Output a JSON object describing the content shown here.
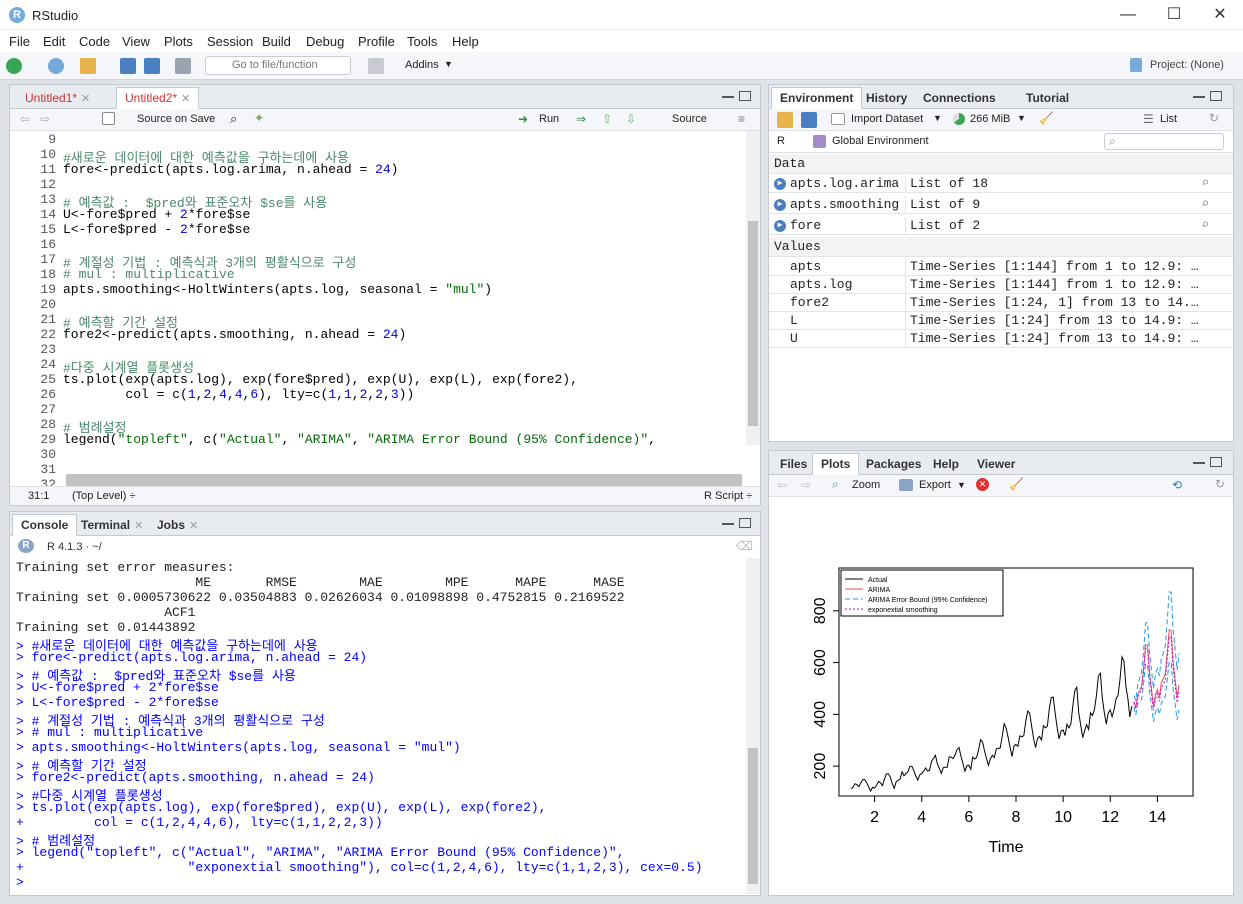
{
  "window": {
    "title": "RStudio",
    "icon_letter": "R",
    "min": "—",
    "max": "☐",
    "close": "✕"
  },
  "menu": [
    "File",
    "Edit",
    "Code",
    "View",
    "Plots",
    "Session",
    "Build",
    "Debug",
    "Profile",
    "Tools",
    "Help"
  ],
  "toolbar": {
    "goto_placeholder": "Go to file/function",
    "addins": "Addins",
    "project": "Project: (None)"
  },
  "editor": {
    "tabs": [
      {
        "label": "Untitled1*"
      },
      {
        "label": "Untitled2*"
      }
    ],
    "source_on_save": "Source on Save",
    "run": "Run",
    "source": "Source",
    "lines": [
      {
        "n": "9",
        "text": ""
      },
      {
        "n": "10",
        "text": "#새로운 데이터에 대한 예측값을 구하는데에 사용"
      },
      {
        "n": "11",
        "text": "fore<-predict(apts.log.arima, n.ahead = 24)"
      },
      {
        "n": "12",
        "text": ""
      },
      {
        "n": "13",
        "text": "# 예측값 :  $pred와 표준오차 $se를 사용"
      },
      {
        "n": "14",
        "text": "U<-fore$pred + 2*fore$se"
      },
      {
        "n": "15",
        "text": "L<-fore$pred - 2*fore$se"
      },
      {
        "n": "16",
        "text": ""
      },
      {
        "n": "17",
        "text": "# 계절성 기법 : 예측식과 3개의 평활식으로 구성"
      },
      {
        "n": "18",
        "text": "# mul : multiplicative"
      },
      {
        "n": "19",
        "text": "apts.smoothing<-HoltWinters(apts.log, seasonal = \"mul\")"
      },
      {
        "n": "20",
        "text": ""
      },
      {
        "n": "21",
        "text": "# 예측할 기간 설정"
      },
      {
        "n": "22",
        "text": "fore2<-predict(apts.smoothing, n.ahead = 24)"
      },
      {
        "n": "23",
        "text": ""
      },
      {
        "n": "24",
        "text": "#다중 시계열 플롯생성"
      },
      {
        "n": "25",
        "text": "ts.plot(exp(apts.log), exp(fore$pred), exp(U), exp(L), exp(fore2),"
      },
      {
        "n": "26",
        "text": "        col = c(1,2,4,4,6), lty=c(1,1,2,2,3))"
      },
      {
        "n": "27",
        "text": ""
      },
      {
        "n": "28",
        "text": "# 범례설정"
      },
      {
        "n": "29",
        "text": "legend(\"topleft\", c(\"Actual\", \"ARIMA\", \"ARIMA Error Bound (95% Confidence)\","
      },
      {
        "n": "30",
        "text": "                      \"exponextial smoothing\"), col=c(1,2,4,6), lty=c(1,1,2,3), cex=0.5"
      },
      {
        "n": "31",
        "text": ""
      },
      {
        "n": "32",
        "text": ""
      }
    ],
    "status_pos": "31:1",
    "status_scope": "(Top Level) ÷",
    "status_type": "R Script ÷"
  },
  "console": {
    "tabs": [
      "Console",
      "Terminal",
      "Jobs"
    ],
    "r_version": "R 4.1.3 · ~/",
    "lines": [
      {
        "t": "Training set error measures:",
        "in": false
      },
      {
        "t": "                       ME       RMSE        MAE        MPE      MAPE      MASE",
        "in": false
      },
      {
        "t": "Training set 0.0005730622 0.03504883 0.02626034 0.01098898 0.4752815 0.2169522",
        "in": false
      },
      {
        "t": "                   ACF1",
        "in": false
      },
      {
        "t": "Training set 0.01443892",
        "in": false
      },
      {
        "t": "> #새로운 데이터에 대한 예측값을 구하는데에 사용",
        "in": true
      },
      {
        "t": "> fore<-predict(apts.log.arima, n.ahead = 24)",
        "in": true
      },
      {
        "t": "> # 예측값 :  $pred와 표준오차 $se를 사용",
        "in": true
      },
      {
        "t": "> U<-fore$pred + 2*fore$se",
        "in": true
      },
      {
        "t": "> L<-fore$pred - 2*fore$se",
        "in": true
      },
      {
        "t": "> # 계절성 기법 : 예측식과 3개의 평활식으로 구성",
        "in": true
      },
      {
        "t": "> # mul : multiplicative",
        "in": true
      },
      {
        "t": "> apts.smoothing<-HoltWinters(apts.log, seasonal = \"mul\")",
        "in": true
      },
      {
        "t": "> # 예측할 기간 설정",
        "in": true
      },
      {
        "t": "> fore2<-predict(apts.smoothing, n.ahead = 24)",
        "in": true
      },
      {
        "t": "> #다중 시계열 플롯생성",
        "in": true
      },
      {
        "t": "> ts.plot(exp(apts.log), exp(fore$pred), exp(U), exp(L), exp(fore2),",
        "in": true
      },
      {
        "t": "+         col = c(1,2,4,4,6), lty=c(1,1,2,2,3))",
        "in": true
      },
      {
        "t": "> # 범례설정",
        "in": true
      },
      {
        "t": "> legend(\"topleft\", c(\"Actual\", \"ARIMA\", \"ARIMA Error Bound (95% Confidence)\",",
        "in": true
      },
      {
        "t": "+                     \"exponextial smoothing\"), col=c(1,2,4,6), lty=c(1,1,2,3), cex=0.5)",
        "in": true
      },
      {
        "t": "> ",
        "in": true
      }
    ]
  },
  "environment": {
    "tabs": [
      "Environment",
      "History",
      "Connections",
      "Tutorial"
    ],
    "import_dataset": "Import Dataset",
    "memory": "266 MiB",
    "view_mode": "List",
    "r_label": "R",
    "global_env": "Global Environment",
    "data_header": "Data",
    "values_header": "Values",
    "data": [
      {
        "name": "apts.log.arima",
        "value": "List of  18"
      },
      {
        "name": "apts.smoothing",
        "value": "List of  9"
      },
      {
        "name": "fore",
        "value": "List of  2"
      }
    ],
    "values": [
      {
        "name": "apts",
        "value": "Time-Series [1:144] from 1 to 12.9: …"
      },
      {
        "name": "apts.log",
        "value": "Time-Series [1:144] from 1 to 12.9: …"
      },
      {
        "name": "fore2",
        "value": "Time-Series [1:24, 1] from 13 to 14.…"
      },
      {
        "name": "L",
        "value": "Time-Series [1:24] from 13 to 14.9: …"
      },
      {
        "name": "U",
        "value": "Time-Series [1:24] from 13 to 14.9: …"
      }
    ]
  },
  "files": {
    "tabs": [
      "Files",
      "Plots",
      "Packages",
      "Help",
      "Viewer"
    ],
    "zoom": "Zoom",
    "export": "Export"
  },
  "chart_data": {
    "type": "line",
    "xlabel": "Time",
    "ylabel": "",
    "xlim": [
      1,
      15
    ],
    "ylim": [
      100,
      950
    ],
    "xticks": [
      "2",
      "4",
      "6",
      "8",
      "10",
      "12",
      "14"
    ],
    "yticks": [
      "200",
      "400",
      "600",
      "800"
    ],
    "legend": {
      "position": "top-left",
      "entries": [
        "Actual",
        "ARIMA",
        "ARIMA Error Bound (95% Confidence)",
        "exponextial smoothing"
      ]
    },
    "colors": {
      "Actual": "#000000",
      "ARIMA": "#df536b",
      "bound": "#2297e6",
      "smoothing": "#cd0bbc"
    },
    "series": [
      {
        "name": "Actual",
        "x_start": 1,
        "step": 0.0833,
        "values": [
          112,
          118,
          132,
          129,
          121,
          135,
          148,
          148,
          136,
          119,
          104,
          118,
          115,
          126,
          141,
          135,
          125,
          149,
          170,
          170,
          158,
          133,
          114,
          140,
          145,
          150,
          178,
          163,
          172,
          178,
          199,
          199,
          184,
          162,
          146,
          166,
          171,
          180,
          193,
          181,
          183,
          218,
          230,
          242,
          209,
          191,
          172,
          194,
          196,
          196,
          236,
          235,
          229,
          243,
          264,
          272,
          237,
          211,
          180,
          201,
          204,
          188,
          235,
          227,
          234,
          264,
          302,
          293,
          259,
          229,
          203,
          229,
          242,
          233,
          267,
          269,
          270,
          315,
          364,
          347,
          312,
          274,
          237,
          278,
          284,
          277,
          317,
          313,
          318,
          374,
          413,
          405,
          355,
          306,
          271,
          306,
          315,
          301,
          356,
          348,
          355,
          422,
          465,
          467,
          404,
          347,
          305,
          336,
          340,
          318,
          362,
          348,
          363,
          435,
          491,
          505,
          404,
          359,
          310,
          337,
          360,
          342,
          406,
          396,
          420,
          472,
          548,
          559,
          463,
          407,
          362,
          405,
          417,
          391,
          419,
          461,
          472,
          535,
          622,
          606,
          508,
          461,
          390,
          432
        ]
      },
      {
        "name": "ARIMA",
        "x_start": 13,
        "step": 0.0833,
        "values": [
          450,
          426,
          479,
          492,
          509,
          583,
          670,
          667,
          558,
          497,
          430,
          477,
          496,
          469,
          522,
          537,
          558,
          637,
          727,
          722,
          603,
          537,
          465,
          515
        ]
      },
      {
        "name": "ARIMA Error Bound (95% Confidence)",
        "x_start": 13,
        "step": 0.0833,
        "values": [
          473,
          455,
          518,
          539,
          564,
          651,
          753,
          755,
          636,
          571,
          499,
          557,
          577,
          549,
          615,
          636,
          664,
          760,
          873,
          872,
          731,
          655,
          571,
          635
        ]
      },
      {
        "name": "ARIMA Error Bound (95% Confidence)",
        "x_start": 13,
        "step": 0.0833,
        "values": [
          428,
          398,
          443,
          449,
          459,
          522,
          596,
          589,
          489,
          433,
          371,
          409,
          426,
          400,
          443,
          453,
          469,
          533,
          605,
          598,
          497,
          440,
          379,
          418
        ]
      },
      {
        "name": "exponextial smoothing",
        "x_start": 13,
        "step": 0.0833,
        "values": [
          446,
          420,
          468,
          481,
          497,
          570,
          655,
          650,
          544,
          482,
          416,
          461,
          480,
          451,
          502,
          516,
          533,
          611,
          701,
          695,
          581,
          515,
          445,
          493
        ]
      }
    ]
  }
}
